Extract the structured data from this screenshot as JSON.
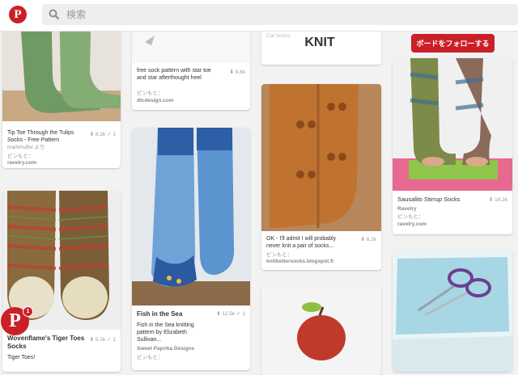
{
  "search": {
    "placeholder": "検索"
  },
  "board": {
    "title": "KNIT",
    "follow_label": "ボードをフォローする"
  },
  "notification_count": "1",
  "pins": {
    "tip_toe": {
      "description": "Tip Toe Through the Tulips Socks - Free Pattern",
      "saves": "8.2k",
      "likes": "1",
      "author": "maihmuffel より",
      "source_label": "ピンもと：",
      "source": "ravelry.com"
    },
    "star_toe": {
      "description": "free sock pattern with star toe and star afterthought heel",
      "saves": "9.6k",
      "source_label": "ピンもと：",
      "source": "dlcdesign.com"
    },
    "top_middle": {
      "partial_text": "Cat Socks"
    },
    "stirrup": {
      "title": "Sausalito Stirrup Socks",
      "saves": "16.2k",
      "author": "Ravelry",
      "source_label": "ピンもと：",
      "source": "ravelry.com"
    },
    "fish": {
      "title": "Fish in the Sea",
      "saves": "12.5k",
      "likes": "1",
      "description": "Fish in the Sea knitting pattern by Elizabeth Sullivan...",
      "author": "Sweet Paprika Designs",
      "source_label": "ピンもと："
    },
    "owl": {
      "description": "OK - I'll admit I will probably never knit a pair of socks...",
      "saves": "8.2k",
      "source_label": "ピンもと：",
      "source": "knitbettersocks.blogspot.fi"
    },
    "tiger": {
      "title": "Wovenflame's Tiger Toes Socks",
      "saves": "5.1k",
      "likes": "1",
      "description": "Tiger Toes!"
    }
  },
  "colors": {
    "brand": "#cb2027"
  }
}
